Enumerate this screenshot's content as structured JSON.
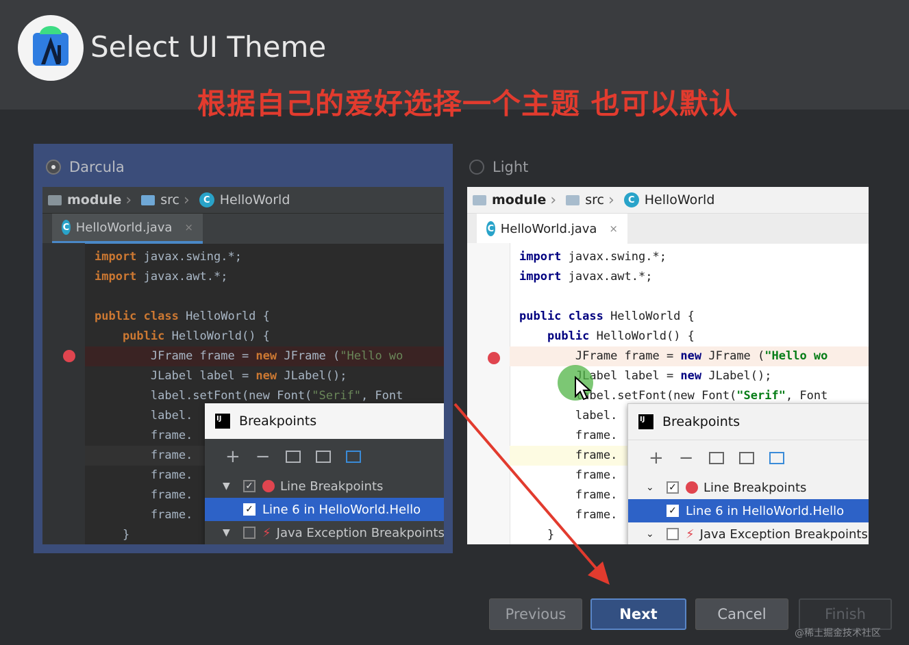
{
  "header": {
    "title": "Select UI Theme",
    "annotation": "根据自己的爱好选择一个主题 也可以默认"
  },
  "themes": {
    "dark": {
      "label": "Darcula",
      "selected": true,
      "breadcrumb": [
        "module",
        "src",
        "HelloWorld"
      ],
      "tab": "HelloWorld.java"
    },
    "light": {
      "label": "Light",
      "selected": false,
      "breadcrumb": [
        "module",
        "src",
        "HelloWorld"
      ],
      "tab": "HelloWorld.java"
    }
  },
  "code": {
    "import1_kw": "import",
    "import1_rest": " javax.swing.*;",
    "import2_kw": "import",
    "import2_rest": " javax.awt.*;",
    "class_kw": "public class",
    "class_rest": " HelloWorld {",
    "ctor_kw": "public",
    "ctor_rest": " HelloWorld() {",
    "line_frame_a": "JFrame frame = ",
    "line_frame_new": "new",
    "line_frame_b": " JFrame (",
    "line_frame_str": "\"Hello wo",
    "line_label_a": "JLabel label = ",
    "line_label_new": "new",
    "line_label_b": " JLabel();",
    "line_font": "label.setFont(new Font(",
    "line_font_str": "\"Serif\"",
    "line_font_end": ", Font",
    "line_label_short": "label.",
    "line_frame_short": "frame.",
    "closing": "}"
  },
  "breakpoints_popup": {
    "title": "Breakpoints",
    "logo": "IJ",
    "toolbar": [
      "+",
      "−"
    ],
    "rows": [
      {
        "label": "Line Breakpoints",
        "checked": true
      },
      {
        "label": "Line 6 in HelloWorld.Hello",
        "checked": true,
        "selected": true
      },
      {
        "label": "Java Exception Breakpoints",
        "checked": false
      }
    ]
  },
  "buttons": {
    "previous": "Previous",
    "next": "Next",
    "cancel": "Cancel",
    "finish": "Finish"
  },
  "watermark": "@稀土掘金技术社区",
  "colors": {
    "accent": "#335082",
    "annotation": "#e23b2e",
    "breakpoint": "#e0454f"
  }
}
